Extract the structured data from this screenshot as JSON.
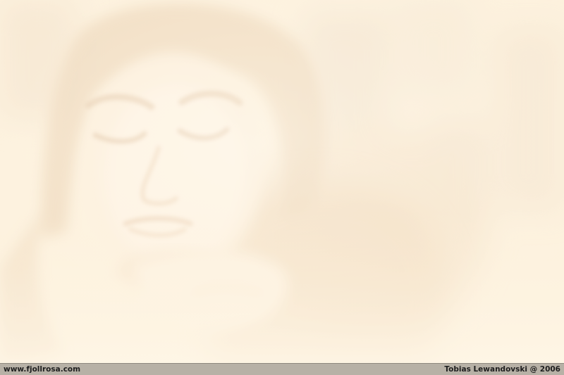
{
  "image": {
    "subject": "faded-portrait",
    "palette": {
      "base": "#fdf1dc",
      "warm_light": "#fff8ea",
      "hair": "#e6c9a6",
      "skin_shadow": "#efd2b2",
      "background_shadow": "#ecd9c2"
    }
  },
  "footer": {
    "website": "www.fjollrosa.com",
    "credit": "Tobias Lewandovski @ 2006",
    "bar_color": "#b7b1a6"
  }
}
